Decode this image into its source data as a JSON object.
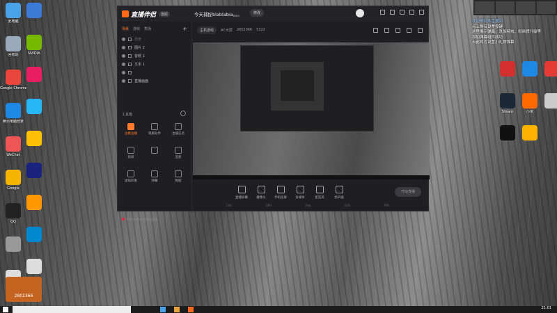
{
  "desktop": {
    "left_icons": [
      {
        "label": "此电脑",
        "color": "#4aa3e8"
      },
      {
        "label": "回收站",
        "color": "#9ab"
      },
      {
        "label": "Google Chrome",
        "color": "#e8453c"
      },
      {
        "label": "腾讯电脑管家",
        "color": "#1e88e5"
      },
      {
        "label": "WeChat",
        "color": "#e55"
      },
      {
        "label": "Google",
        "color": "#f4b400"
      },
      {
        "label": "QQ",
        "color": "#222"
      },
      {
        "label": "",
        "color": "#999"
      },
      {
        "label": "",
        "color": "#ddd"
      }
    ],
    "second_col_icons": [
      {
        "label": "",
        "color": "#3a7bd5"
      },
      {
        "label": "NVIDIA",
        "color": "#76b900"
      },
      {
        "label": "",
        "color": "#e91e63"
      },
      {
        "label": "",
        "color": "#29b6f6"
      },
      {
        "label": "",
        "color": "#ffc107"
      },
      {
        "label": "",
        "color": "#1a237e"
      },
      {
        "label": "",
        "color": "#ff9800"
      },
      {
        "label": "",
        "color": "#0288d1"
      },
      {
        "label": "",
        "color": "#ddd"
      }
    ],
    "right_icons": [
      {
        "label": "",
        "color": "#d32f2f"
      },
      {
        "label": "",
        "color": "#1e88e5"
      },
      {
        "label": "",
        "color": "#e53935"
      },
      {
        "label": "Steam",
        "color": "#1b2838"
      },
      {
        "label": "小米",
        "color": "#ff6900"
      },
      {
        "label": "",
        "color": "#ccc"
      },
      {
        "label": "",
        "color": "#111"
      },
      {
        "label": "",
        "color": "#ffb300"
      }
    ],
    "bottom_overlay_number": "2802366",
    "clock": "21:01"
  },
  "app": {
    "logo_text": "直播伴侣",
    "version_badge": "旗舰",
    "room_title": "今天捕捉blablabia。。。",
    "edit_label": "修改",
    "left_tabs": [
      "场景",
      "游戏",
      "秀场"
    ],
    "scenes": [
      {
        "label": "场景",
        "dim": true
      },
      {
        "label": "图片 2",
        "dim": false
      },
      {
        "label": "音频 1",
        "dim": false
      },
      {
        "label": "文本 1",
        "dim": false
      },
      {
        "label": "",
        "dim": true
      },
      {
        "label": "直播画面",
        "dim": false
      }
    ],
    "tools_title": "工具箱",
    "tools": [
      {
        "label": "边看边播",
        "hot": true
      },
      {
        "label": "观看助手",
        "hot": false
      },
      {
        "label": "主播任务",
        "hot": false
      },
      {
        "label": "投屏",
        "hot": false
      },
      {
        "label": "",
        "hot": false
      },
      {
        "label": "连麦",
        "hot": false
      },
      {
        "label": "虚拟形象",
        "hot": false
      },
      {
        "label": "弹幕",
        "hot": false
      },
      {
        "label": "数据",
        "hot": false
      }
    ],
    "tip_text": "今晚直播中的其他直播",
    "info_category": "主机游戏",
    "info_room": "AC大屏",
    "info_id": "2802366",
    "info_fans": "5322",
    "controls": [
      {
        "label": "直播屏幕"
      },
      {
        "label": "摄像头"
      },
      {
        "label": "手机投屏"
      },
      {
        "label": "多媒体"
      },
      {
        "label": "麦克风"
      },
      {
        "label": "扬声器"
      }
    ],
    "start_label": "开始直播",
    "stats": [
      "CPU",
      "GPU",
      "内存",
      "码率",
      "FPS"
    ]
  },
  "chat": {
    "lines": [
      {
        "text": "欢迎来到本直播间",
        "sys": true
      },
      {
        "text": "点上角有设置按键",
        "sys": false
      },
      {
        "text": "这里展示弹幕、贵族特效、粉丝牌升级等",
        "sys": false
      },
      {
        "text": "添加弹幕组件成功",
        "sys": false
      },
      {
        "text": "点此将可设置小礼物弹幕",
        "sys": false
      }
    ]
  }
}
